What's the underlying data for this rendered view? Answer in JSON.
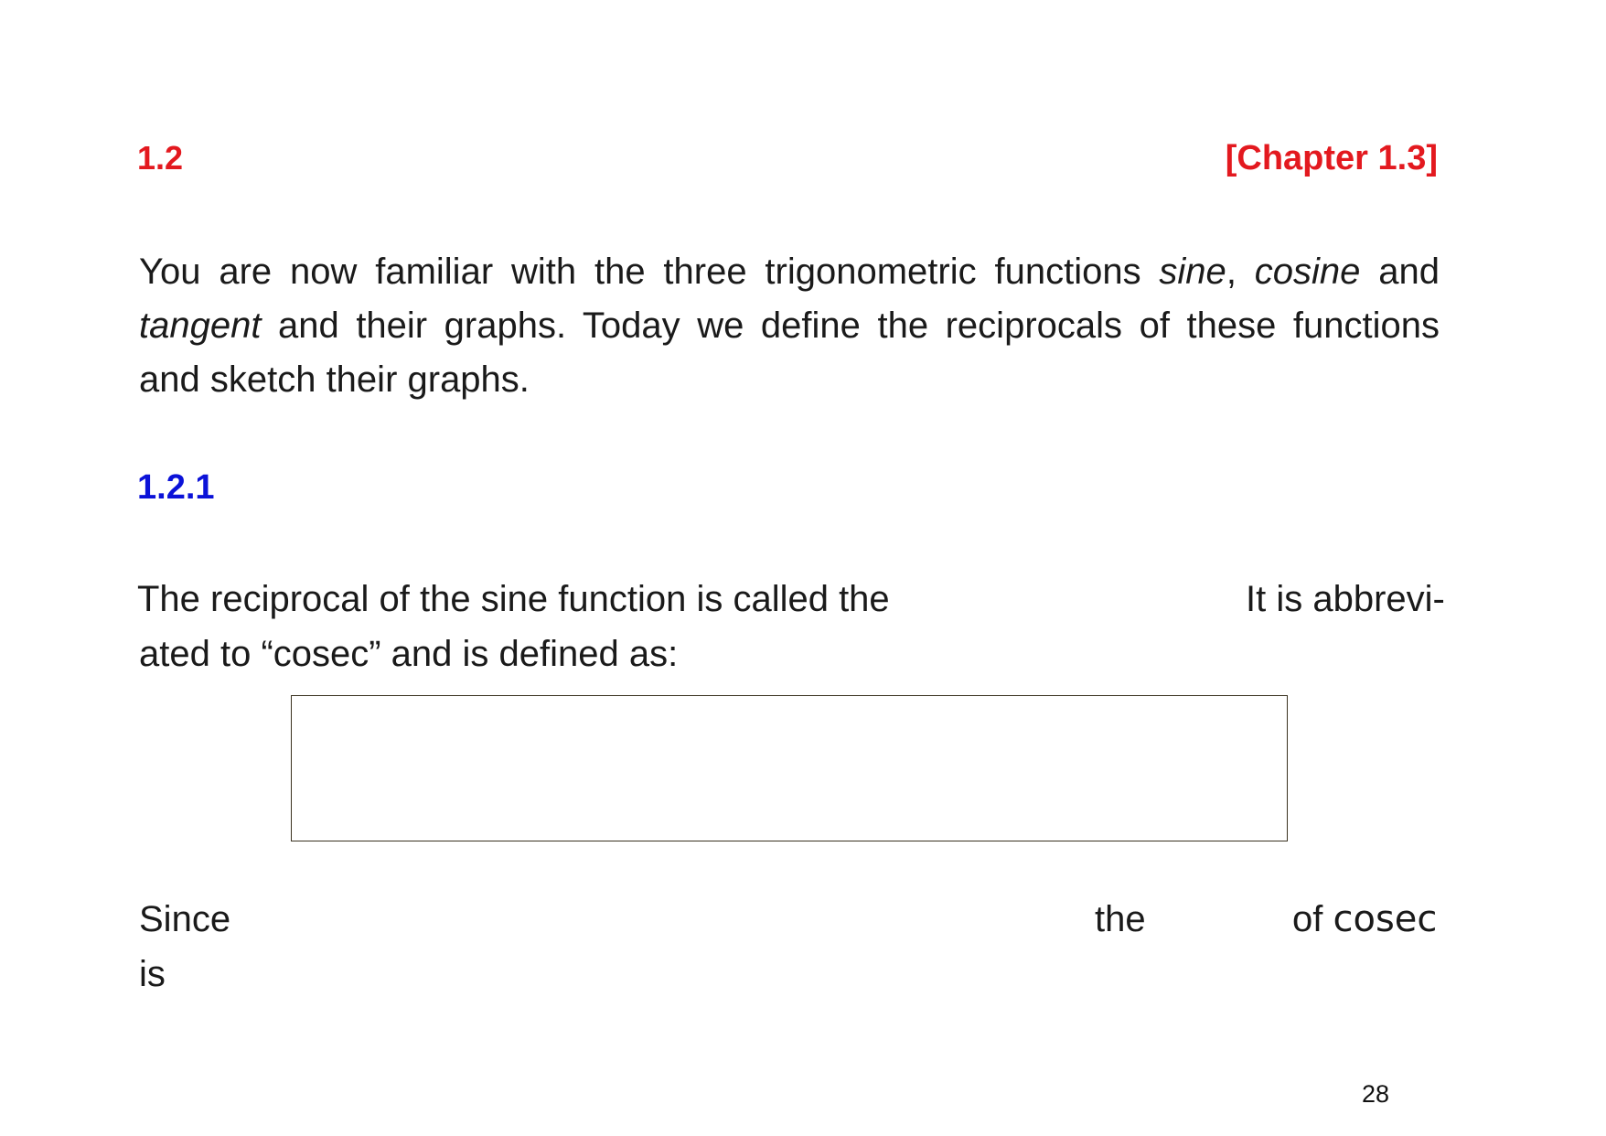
{
  "header": {
    "section_number": "1.2",
    "chapter_ref": "[Chapter 1.3]"
  },
  "intro": {
    "line1_a": "You are now familiar with the three trigonometric functions ",
    "line1_sine": "sine",
    "line1_comma": ", ",
    "line1_cosine": "cosine",
    "line1_and": " and",
    "line2_tangent": "tangent",
    "line2_rest": " and their graphs. Today we define the reciprocals of these functions",
    "line3": "and sketch their graphs."
  },
  "subsection": {
    "number": "1.2.1"
  },
  "paragraph2": {
    "part1": "The reciprocal of the sine function is called the",
    "part2": "It is abbrevi-",
    "part3": "ated to “cosec” and is defined as:"
  },
  "paragraph3": {
    "part1": "Since",
    "part2": "the",
    "part3_of": "of ",
    "part3_cosec": "cosec",
    "part4": "is"
  },
  "footer": {
    "page_number": "28"
  }
}
